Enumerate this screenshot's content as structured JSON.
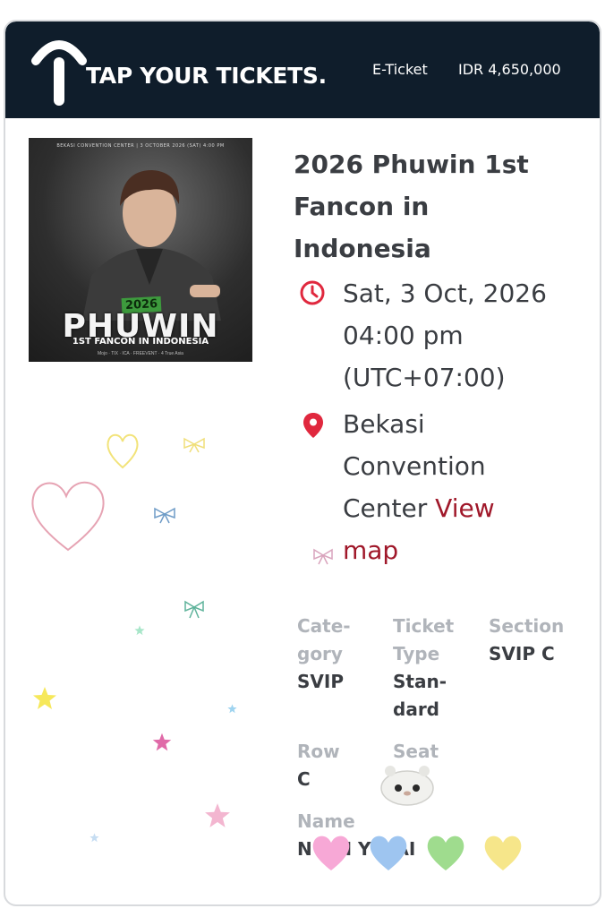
{
  "header": {
    "brand": "TAP YOUR TICKETS.",
    "ticket_kind": "E-Ticket",
    "price": "IDR 4,650,000"
  },
  "poster": {
    "venue_line": "BEKASI CONVENTION CENTER | 3 OCTOBER 2026 (SAT) 4:00 PM",
    "year": "2026",
    "name": "PHUWIN",
    "subtitle": "1ST FANCON IN INDONESIA",
    "sponsors": "Mojo · TIX · ICA · FREEVENT · 4 True Asia"
  },
  "event": {
    "title": "2026 Phuwin 1st Fancon in Indonesia",
    "date": "Sat, 3 Oct, 2026",
    "time": "04:00 pm",
    "timezone": "(UTC+07:00)",
    "venue": "Bekasi Convention Center",
    "view_map_label": "View map"
  },
  "details": {
    "category_label": "Cate-\ngory",
    "category_value": "SVIP",
    "ticket_type_label": "Ticket\nType",
    "ticket_type_value": "Stan-\ndard",
    "section_label": "Section",
    "section_value": "SVIP C",
    "row_label": "Row",
    "row_value": "C",
    "seat_label": "Seat",
    "name_label": "Name",
    "name_value": "N  E  H  Y  MAI"
  },
  "colors": {
    "header_bg": "#0f1d2b",
    "accent": "#a0182a",
    "icon_red": "#e0283e",
    "text": "#3a3d42",
    "label": "#b0b4ba"
  },
  "icons": {
    "brand": "tap-logo-icon",
    "date": "clock-icon",
    "venue": "map-pin-icon"
  }
}
